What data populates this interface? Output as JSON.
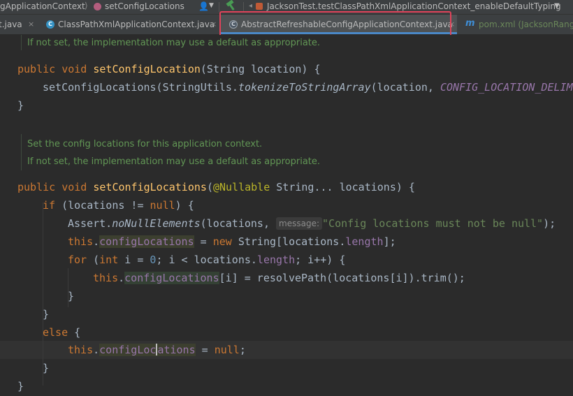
{
  "navbar": {
    "crumb_class": "gApplicationContext",
    "crumb_method": "setConfigLocations",
    "run_config": "JacksonTest.testClassPathXmlApplicationContext_enableDefaultTyping"
  },
  "tabs": [
    {
      "label": "t.java",
      "close": "×"
    },
    {
      "icon_letter": "C",
      "label": "ClassPathXmlApplicationContext.java",
      "close": "×"
    },
    {
      "icon_letter": "C",
      "label": "AbstractRefreshableConfigApplicationContext.java",
      "close": "×",
      "active": true
    },
    {
      "icon_letter": "m",
      "label": "pom.xml (JacksonRang"
    }
  ],
  "doc1": {
    "line1": "If not set, the implementation may use a default as appropriate."
  },
  "doc2": {
    "line1": "Set the config locations for this application context.",
    "line2": "If not set, the implementation may use a default as appropriate."
  },
  "code": {
    "kw_public": "public",
    "kw_void": "void",
    "method1": "setConfigLocation",
    "params1": "(String location) {",
    "call1": "setConfigLocations(StringUtils.",
    "call1_static": "tokenizeToStringArray",
    "call1_args": "(location, ",
    "call1_const": "CONFIG_LOCATION_DELIMITERS",
    "brace_close": "}",
    "method2": "setConfigLocations",
    "params2_open": "(",
    "annotation": "@Nullable",
    "params2_rest": " String... locations) {",
    "kw_if": "if",
    "if_cond_a": " (locations != ",
    "kw_null": "null",
    "if_cond_b": ") {",
    "assert_prefix": "Assert.",
    "assert_method": "noNullElements",
    "assert_args_a": "(locations, ",
    "hint_message": "message:",
    "assert_string": "\"Config locations must not be null\"",
    "assert_end": ");",
    "kw_this": "this",
    "dot": ".",
    "field_config": "configLocations",
    "field_config_a": "configLoc",
    "field_config_b": "ations",
    "assign": " = ",
    "kw_new": "new",
    "new_rest_a": " String[locations.",
    "field_length": "length",
    "new_rest_b": "];",
    "kw_for": "for",
    "for_a": " (",
    "kw_int": "int",
    "for_b": " i = ",
    "num_zero": "0",
    "for_c": "; i < locations.",
    "for_d": "; i++) {",
    "loop_body_a": "[i] = resolvePath(locations[i]).trim();",
    "kw_else": "else",
    "else_open": " {",
    "semicolon": ";"
  }
}
